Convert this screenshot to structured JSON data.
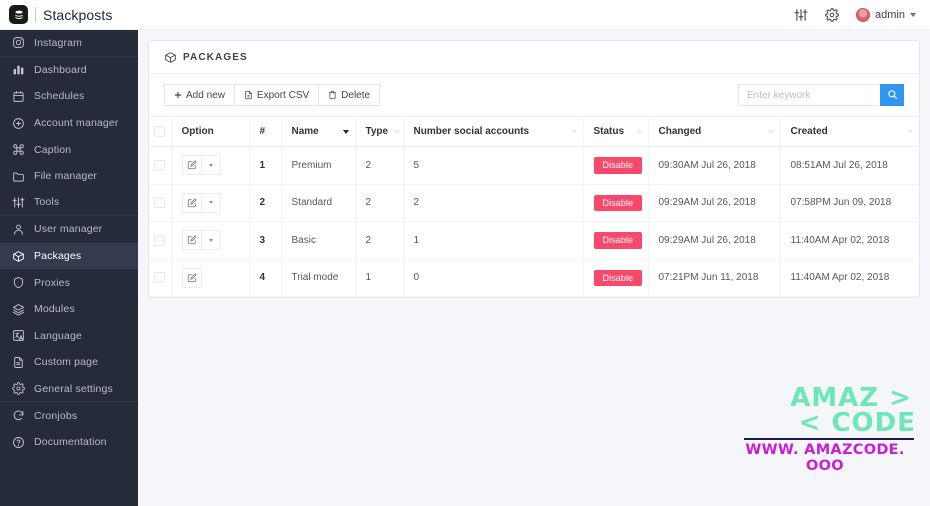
{
  "topbar": {
    "brand_name": "Stackposts",
    "logo_icon": "stacked-layers-icon",
    "sliders_icon": "sliders-icon",
    "gear_icon": "gear-icon",
    "user_name": "admin",
    "user_caret_icon": "chevron-down-icon"
  },
  "sidebar": {
    "items": [
      {
        "label": "Instagram",
        "icon": "instagram-icon",
        "active": false,
        "separator_after": true
      },
      {
        "label": "Dashboard",
        "icon": "bar-chart-icon",
        "active": false,
        "separator_after": false
      },
      {
        "label": "Schedules",
        "icon": "calendar-icon",
        "active": false,
        "separator_after": false
      },
      {
        "label": "Account manager",
        "icon": "plus-circle-icon",
        "active": false,
        "separator_after": false
      },
      {
        "label": "Caption",
        "icon": "command-icon",
        "active": false,
        "separator_after": false
      },
      {
        "label": "File manager",
        "icon": "folder-icon",
        "active": false,
        "separator_after": false
      },
      {
        "label": "Tools",
        "icon": "sliders-icon",
        "active": false,
        "separator_after": true
      },
      {
        "label": "User manager",
        "icon": "user-icon",
        "active": false,
        "separator_after": false
      },
      {
        "label": "Packages",
        "icon": "package-icon",
        "active": true,
        "separator_after": false
      },
      {
        "label": "Proxies",
        "icon": "shield-icon",
        "active": false,
        "separator_after": false
      },
      {
        "label": "Modules",
        "icon": "layers-icon",
        "active": false,
        "separator_after": false
      },
      {
        "label": "Language",
        "icon": "language-icon",
        "active": false,
        "separator_after": false
      },
      {
        "label": "Custom page",
        "icon": "file-text-icon",
        "active": false,
        "separator_after": false
      },
      {
        "label": "General settings",
        "icon": "gear-icon",
        "active": false,
        "separator_after": true
      },
      {
        "label": "Cronjobs",
        "icon": "refresh-icon",
        "active": false,
        "separator_after": false
      },
      {
        "label": "Documentation",
        "icon": "help-circle-icon",
        "active": false,
        "separator_after": false
      }
    ]
  },
  "panel": {
    "title": "PACKAGES",
    "title_icon": "package-icon"
  },
  "toolbar": {
    "add_new_label": "Add new",
    "add_new_icon": "plus-icon",
    "export_csv_label": "Export CSV",
    "export_csv_icon": "file-export-icon",
    "delete_label": "Delete",
    "delete_icon": "trash-icon",
    "search_placeholder": "Enter keywork",
    "search_value": "",
    "search_icon": "search-icon"
  },
  "table": {
    "columns": [
      {
        "label": "Option",
        "sortable": false,
        "sort_active": false
      },
      {
        "label": "#",
        "sortable": false,
        "sort_active": false
      },
      {
        "label": "Name",
        "sortable": true,
        "sort_active": true
      },
      {
        "label": "Type",
        "sortable": true,
        "sort_active": false
      },
      {
        "label": "Number social accounts",
        "sortable": true,
        "sort_active": false
      },
      {
        "label": "Status",
        "sortable": true,
        "sort_active": false
      },
      {
        "label": "Changed",
        "sortable": true,
        "sort_active": false
      },
      {
        "label": "Created",
        "sortable": true,
        "sort_active": false
      }
    ],
    "rows": [
      {
        "index": "1",
        "name": "Premium",
        "type": "2",
        "accounts": "5",
        "status": "Disable",
        "changed": "09:30AM Jul 26, 2018",
        "created": "08:51AM Jul 26, 2018",
        "has_dropdown": true
      },
      {
        "index": "2",
        "name": "Standard",
        "type": "2",
        "accounts": "2",
        "status": "Disable",
        "changed": "09:29AM Jul 26, 2018",
        "created": "07:58PM Jun 09, 2018",
        "has_dropdown": true
      },
      {
        "index": "3",
        "name": "Basic",
        "type": "2",
        "accounts": "1",
        "status": "Disable",
        "changed": "09:29AM Jul 26, 2018",
        "created": "11:40AM Apr 02, 2018",
        "has_dropdown": true
      },
      {
        "index": "4",
        "name": "Trial mode",
        "type": "1",
        "accounts": "0",
        "status": "Disable",
        "changed": "07:21PM Jun 11, 2018",
        "created": "11:40AM Apr 02, 2018",
        "has_dropdown": false
      }
    ],
    "edit_icon": "edit-pencil-icon",
    "dropdown_icon": "caret-down-icon"
  },
  "watermark": {
    "line1": "AMAZ >",
    "line2": "< CODE",
    "line3": "WWW. AMAZCODE. OOO",
    "color_green": "#6ee7b7",
    "color_magenta": "#c81ed6"
  },
  "colors": {
    "sidebar_bg": "#262b3a",
    "sidebar_active": "#323b4f",
    "accent_blue": "#3196f3",
    "badge_red": "#f8486b",
    "page_bg": "#f4f6fa"
  }
}
